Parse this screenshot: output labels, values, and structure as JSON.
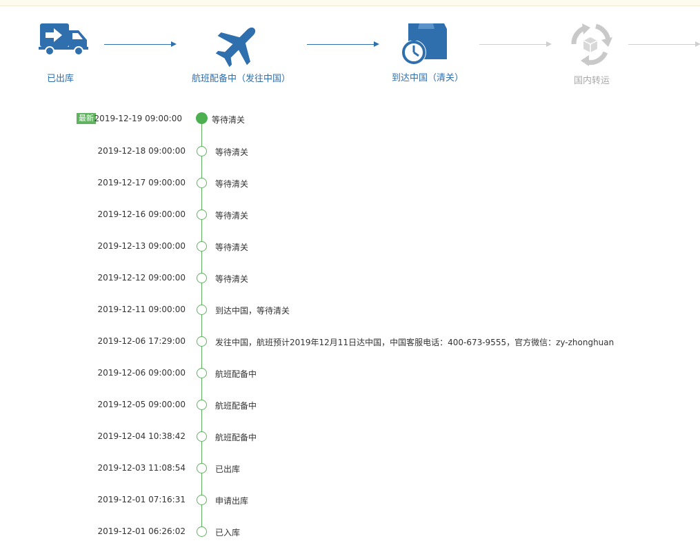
{
  "colors": {
    "active": "#2f6fae",
    "inactive": "#c9c9c9",
    "timeline_green": "#5fb35f"
  },
  "steps": [
    {
      "label": "已出库",
      "icon": "truck-arrow-icon",
      "state": "active"
    },
    {
      "label": "航班配备中（发往中国）",
      "icon": "airplane-icon",
      "state": "active"
    },
    {
      "label": "到达中国（清关）",
      "icon": "box-stopwatch-icon",
      "state": "active"
    },
    {
      "label": "国内转运",
      "icon": "transfer-cycle-icon",
      "state": "inactive"
    }
  ],
  "timeline": {
    "latest_badge": "最新",
    "events": [
      {
        "date": "2019-12-19 09:00:00",
        "desc": "等待清关"
      },
      {
        "date": "2019-12-18 09:00:00",
        "desc": "等待清关"
      },
      {
        "date": "2019-12-17 09:00:00",
        "desc": "等待清关"
      },
      {
        "date": "2019-12-16 09:00:00",
        "desc": "等待清关"
      },
      {
        "date": "2019-12-13 09:00:00",
        "desc": "等待清关"
      },
      {
        "date": "2019-12-12 09:00:00",
        "desc": "等待清关"
      },
      {
        "date": "2019-12-11 09:00:00",
        "desc": "到达中国，等待清关"
      },
      {
        "date": "2019-12-06 17:29:00",
        "desc": "发往中国，航班预计2019年12月11日达中国，中国客服电话：400-673-9555，官方微信：zy-zhonghuan"
      },
      {
        "date": "2019-12-06 09:00:00",
        "desc": "航班配备中"
      },
      {
        "date": "2019-12-05 09:00:00",
        "desc": "航班配备中"
      },
      {
        "date": "2019-12-04 10:38:42",
        "desc": "航班配备中"
      },
      {
        "date": "2019-12-03 11:08:54",
        "desc": "已出库"
      },
      {
        "date": "2019-12-01 07:16:31",
        "desc": "申请出库"
      },
      {
        "date": "2019-12-01 06:26:02",
        "desc": "已入库"
      }
    ]
  }
}
